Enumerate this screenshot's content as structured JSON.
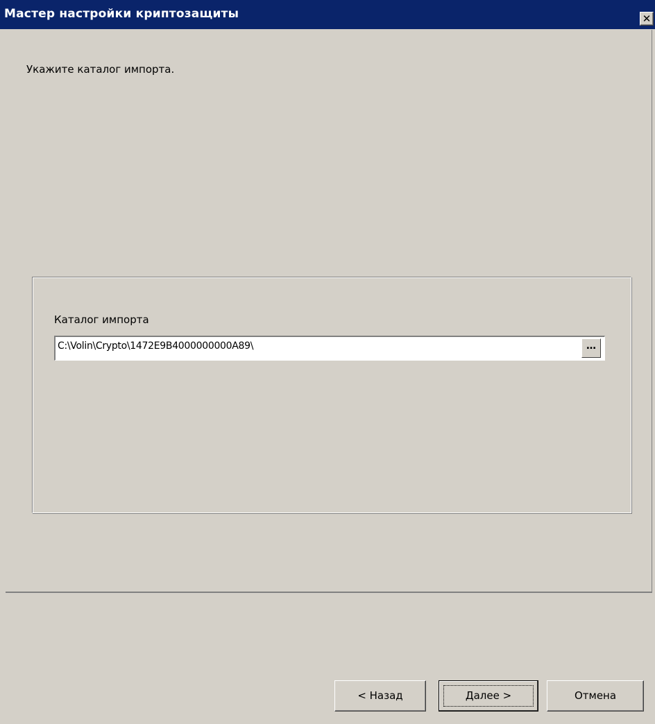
{
  "window": {
    "title": "Мастер настройки криптозащиты",
    "close_glyph": "✕"
  },
  "wizard": {
    "instruction": "Укажите каталог импорта."
  },
  "import_group": {
    "label": "Каталог импорта",
    "path_value": "C:\\Volin\\Crypto\\1472E9B4000000000A89\\",
    "browse_glyph": "…"
  },
  "buttons": {
    "back": "< Назад",
    "next": "Далее >",
    "cancel": "Отмена"
  },
  "colors": {
    "titlebar": "#0a246a",
    "face": "#d4d0c8"
  }
}
